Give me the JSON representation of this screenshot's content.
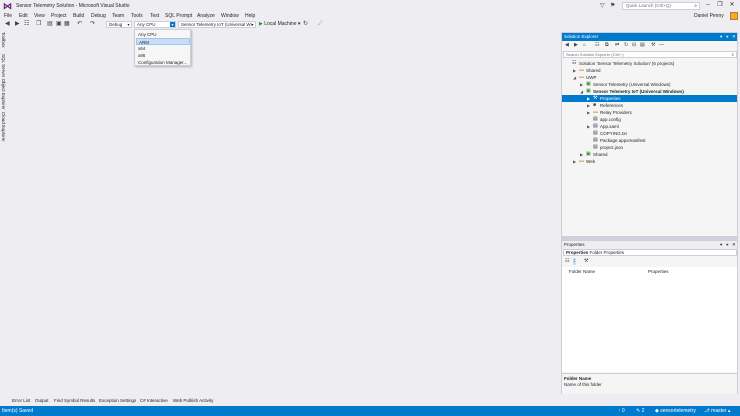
{
  "window": {
    "title": "Sensor Telemetry Solution - Microsoft Visual Studio",
    "quick_launch_placeholder": "Quick Launch (Ctrl+Q)",
    "user_name": "Daniel Penny",
    "minimize": "–",
    "maximize": "❐",
    "close": "✕"
  },
  "menu": [
    "File",
    "Edit",
    "View",
    "Project",
    "Build",
    "Debug",
    "Team",
    "Tools",
    "Test",
    "SQL Prompt",
    "Analyze",
    "Window",
    "Help"
  ],
  "toolbar": {
    "configuration": "Debug",
    "platform": "Any CPU",
    "startup_project": "Sensor Telemetry IoT (Universal Wi",
    "start_target": "Local Machine"
  },
  "platform_dropdown": {
    "options": [
      "Any CPU",
      "ARM",
      "x64",
      "x86",
      "Configuration Manager..."
    ],
    "highlighted": "ARM"
  },
  "left_tabs": [
    "Toolbox",
    "SQL Server Object Explorer",
    "Cloud Explorer"
  ],
  "bottom_tabs": [
    "Error List",
    "Output",
    "Find Symbol Results",
    "Exception Settings",
    "C# Interactive",
    "Web Publish Activity"
  ],
  "status": {
    "message": "Item(s) Saved",
    "up_count": "0",
    "edit_count": "2",
    "repo": "sensortelemetry",
    "branch": "master"
  },
  "solution_explorer": {
    "title": "Solution Explorer",
    "search_placeholder": "Search Solution Explorer (Ctrl+;)",
    "tree": [
      {
        "label": "Solution 'Sensor Telemetry Solution' (6 projects)",
        "level": 0,
        "expander": "",
        "icon": "solution"
      },
      {
        "label": "Shared",
        "level": 1,
        "expander": "▶",
        "icon": "folder"
      },
      {
        "label": "UWP",
        "level": 1,
        "expander": "◢",
        "icon": "folder"
      },
      {
        "label": "Sensor Telemetry (Universal Windows)",
        "level": 2,
        "expander": "▶",
        "icon": "project"
      },
      {
        "label": "Sensor Telemetry IoT (Universal Windows)",
        "level": 2,
        "expander": "◢",
        "icon": "project",
        "bold": true
      },
      {
        "label": "Properties",
        "level": 3,
        "expander": "▶",
        "icon": "wrench",
        "selected": true
      },
      {
        "label": "References",
        "level": 3,
        "expander": "▶",
        "icon": "references"
      },
      {
        "label": "Relay Providers",
        "level": 3,
        "expander": "▶",
        "icon": "folder"
      },
      {
        "label": "app.config",
        "level": 3,
        "expander": "",
        "icon": "file"
      },
      {
        "label": "App.xaml",
        "level": 3,
        "expander": "▶",
        "icon": "file"
      },
      {
        "label": "COPYING.txt",
        "level": 3,
        "expander": "",
        "icon": "file"
      },
      {
        "label": "Package.appxmanifest",
        "level": 3,
        "expander": "",
        "icon": "file"
      },
      {
        "label": "project.json",
        "level": 3,
        "expander": "",
        "icon": "file"
      },
      {
        "label": "Shared",
        "level": 2,
        "expander": "▶",
        "icon": "project"
      },
      {
        "label": "Web",
        "level": 1,
        "expander": "▶",
        "icon": "folder"
      }
    ]
  },
  "properties": {
    "title": "Properties",
    "object_label": "Properties",
    "object_type": "Folder Properties",
    "col_name": "Folder Name",
    "col_value": "Properties",
    "desc_title": "Folder Name",
    "desc_text": "Name of this folder"
  },
  "colors": {
    "accent": "#007acc",
    "vs_purple": "#68217a",
    "folder": "#dcb67a",
    "selected_item": "#c9def5"
  }
}
